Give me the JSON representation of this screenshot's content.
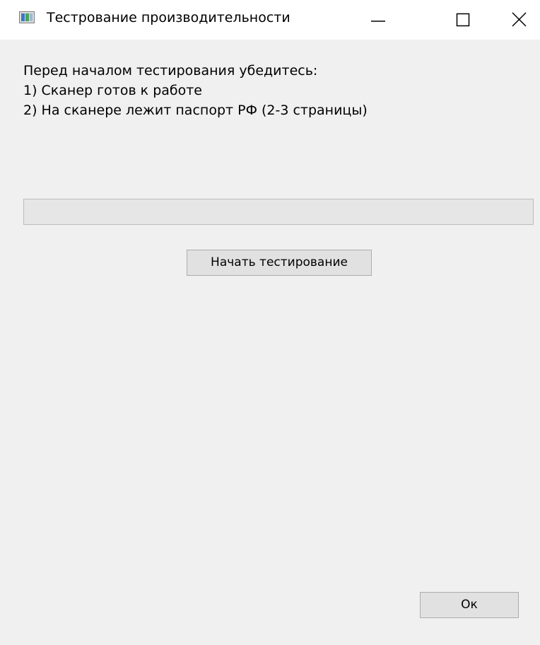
{
  "window": {
    "title": "Тестрование производительности",
    "icon": "app-window-icon",
    "controls": {
      "minimize": "minimize-icon",
      "maximize": "maximize-icon",
      "close": "close-icon"
    }
  },
  "instructions": {
    "heading": "Перед началом тестирования убедитесь:",
    "items": [
      "1) Сканер готов к работе",
      "2) На сканере лежит паспорт РФ (2-3 страницы)"
    ]
  },
  "progress": {
    "value": 0,
    "fill_color": "#06b025"
  },
  "buttons": {
    "start_label": "Начать тестирование",
    "ok_label": "Ок"
  }
}
